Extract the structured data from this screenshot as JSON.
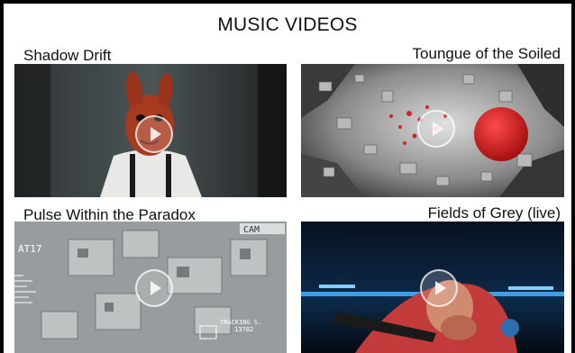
{
  "header": {
    "title": "MUSIC VIDEOS"
  },
  "videos": [
    {
      "title": "Shadow Drift",
      "play_icon": "play-icon"
    },
    {
      "title": "Toungue of the Soiled",
      "play_icon": "play-icon"
    },
    {
      "title": "Pulse Within the Paradox",
      "play_icon": "play-icon",
      "hud": {
        "top_label": "CAM",
        "code": "AT17",
        "tracking": "TRACKING S.",
        "tracking_code": "13782"
      }
    },
    {
      "title": "Fields of Grey (live)",
      "play_icon": "play-icon"
    }
  ],
  "colors": {
    "background": "#000000",
    "panel": "#ffffff",
    "text": "#111111",
    "accent_red": "#d01f1f",
    "stage_blue": "#1f6fb8"
  }
}
